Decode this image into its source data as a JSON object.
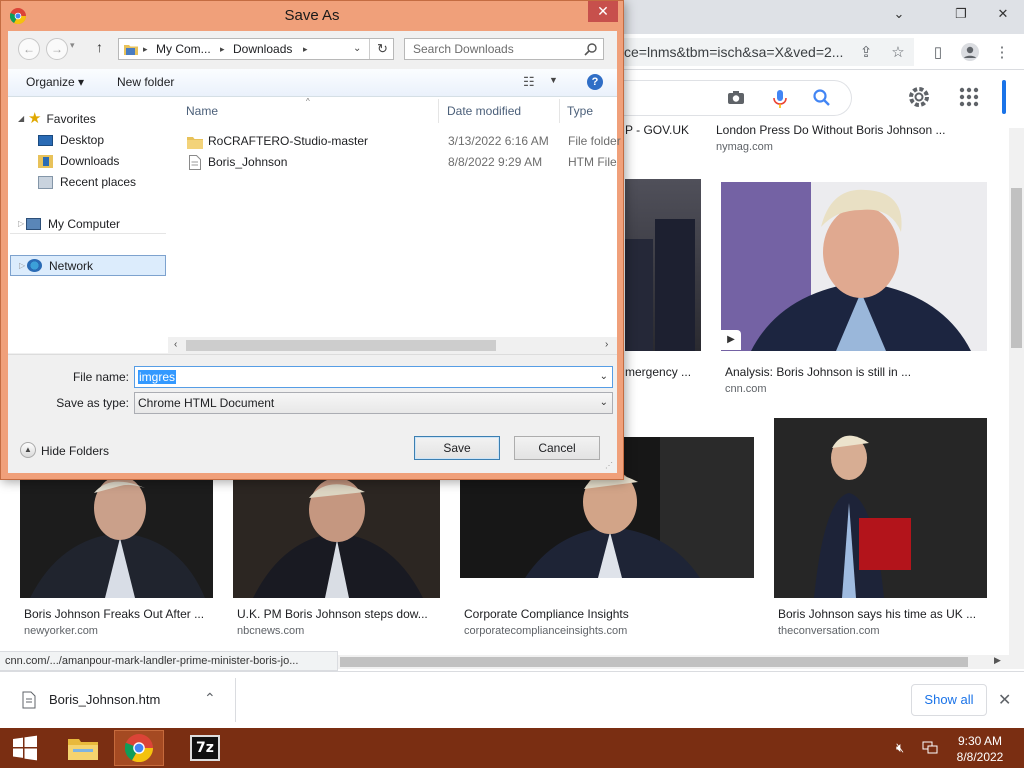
{
  "browser": {
    "url_text": "ce=lnms&tbm=isch&sa=X&ved=2...",
    "status_url": "cnn.com/.../amanpour-mark-landler-prime-minister-boris-jo..."
  },
  "results": {
    "top": [
      {
        "caption": "P - GOV.UK",
        "source": ""
      },
      {
        "caption": "London Press Do Without Boris Johnson ...",
        "source": "nymag.com"
      }
    ],
    "mid": [
      {
        "caption": "mergency ...",
        "source": ""
      },
      {
        "caption": "Analysis: Boris Johnson is still in ...",
        "source": "cnn.com"
      }
    ],
    "bottom": [
      {
        "caption": "Boris Johnson Freaks Out After ...",
        "source": "newyorker.com"
      },
      {
        "caption": "U.K. PM Boris Johnson steps dow...",
        "source": "nbcnews.com"
      },
      {
        "caption": "Corporate Compliance Insights",
        "source": "corporatecomplianceinsights.com"
      },
      {
        "caption": "Boris Johnson says his time as UK ...",
        "source": "theconversation.com"
      }
    ]
  },
  "downloads": {
    "file": "Boris_Johnson.htm",
    "show_all": "Show all"
  },
  "dialog": {
    "title": "Save As",
    "close": "✕",
    "breadcrumb": [
      "My Com...",
      "Downloads"
    ],
    "search_placeholder": "Search Downloads",
    "organize": "Organize ▾",
    "new_folder": "New folder",
    "nav": {
      "favorites": "Favorites",
      "desktop": "Desktop",
      "downloads": "Downloads",
      "recent": "Recent places",
      "computer": "My Computer",
      "network": "Network"
    },
    "columns": {
      "name": "Name",
      "date": "Date modified",
      "type": "Type"
    },
    "files": [
      {
        "name": "RoCRAFTERO-Studio-master",
        "date": "3/13/2022 6:16 AM",
        "type": "File folder",
        "kind": "folder"
      },
      {
        "name": "Boris_Johnson",
        "date": "8/8/2022 9:29 AM",
        "type": "HTM File",
        "kind": "file"
      }
    ],
    "file_name_label": "File name:",
    "file_name_value": "imgres",
    "save_type_label": "Save as type:",
    "save_type_value": "Chrome HTML Document",
    "hide_folders": "Hide Folders",
    "save": "Save",
    "cancel": "Cancel"
  },
  "taskbar": {
    "time": "9:30 AM",
    "date": "8/8/2022"
  },
  "colors": {
    "dialog_frame": "#f0a07a",
    "taskbar": "#7a2e12",
    "selection": "#3399ff"
  }
}
